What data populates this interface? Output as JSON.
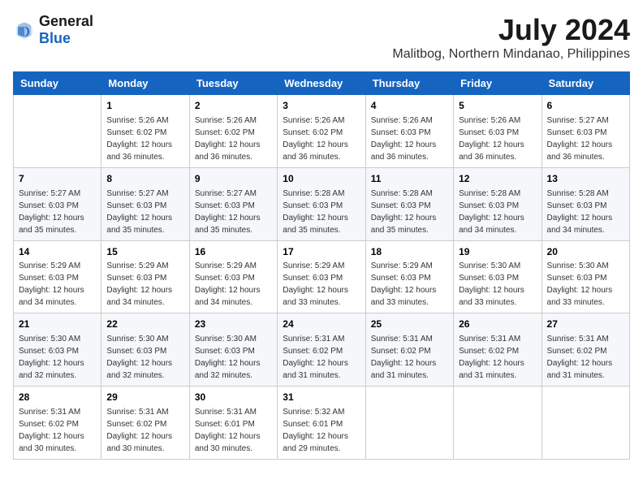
{
  "logo": {
    "text_general": "General",
    "text_blue": "Blue"
  },
  "title": {
    "month_year": "July 2024",
    "location": "Malitbog, Northern Mindanao, Philippines"
  },
  "weekdays": [
    "Sunday",
    "Monday",
    "Tuesday",
    "Wednesday",
    "Thursday",
    "Friday",
    "Saturday"
  ],
  "weeks": [
    [
      {
        "day": "",
        "sunrise": "",
        "sunset": "",
        "daylight": ""
      },
      {
        "day": "1",
        "sunrise": "Sunrise: 5:26 AM",
        "sunset": "Sunset: 6:02 PM",
        "daylight": "Daylight: 12 hours and 36 minutes."
      },
      {
        "day": "2",
        "sunrise": "Sunrise: 5:26 AM",
        "sunset": "Sunset: 6:02 PM",
        "daylight": "Daylight: 12 hours and 36 minutes."
      },
      {
        "day": "3",
        "sunrise": "Sunrise: 5:26 AM",
        "sunset": "Sunset: 6:02 PM",
        "daylight": "Daylight: 12 hours and 36 minutes."
      },
      {
        "day": "4",
        "sunrise": "Sunrise: 5:26 AM",
        "sunset": "Sunset: 6:03 PM",
        "daylight": "Daylight: 12 hours and 36 minutes."
      },
      {
        "day": "5",
        "sunrise": "Sunrise: 5:26 AM",
        "sunset": "Sunset: 6:03 PM",
        "daylight": "Daylight: 12 hours and 36 minutes."
      },
      {
        "day": "6",
        "sunrise": "Sunrise: 5:27 AM",
        "sunset": "Sunset: 6:03 PM",
        "daylight": "Daylight: 12 hours and 36 minutes."
      }
    ],
    [
      {
        "day": "7",
        "sunrise": "Sunrise: 5:27 AM",
        "sunset": "Sunset: 6:03 PM",
        "daylight": "Daylight: 12 hours and 35 minutes."
      },
      {
        "day": "8",
        "sunrise": "Sunrise: 5:27 AM",
        "sunset": "Sunset: 6:03 PM",
        "daylight": "Daylight: 12 hours and 35 minutes."
      },
      {
        "day": "9",
        "sunrise": "Sunrise: 5:27 AM",
        "sunset": "Sunset: 6:03 PM",
        "daylight": "Daylight: 12 hours and 35 minutes."
      },
      {
        "day": "10",
        "sunrise": "Sunrise: 5:28 AM",
        "sunset": "Sunset: 6:03 PM",
        "daylight": "Daylight: 12 hours and 35 minutes."
      },
      {
        "day": "11",
        "sunrise": "Sunrise: 5:28 AM",
        "sunset": "Sunset: 6:03 PM",
        "daylight": "Daylight: 12 hours and 35 minutes."
      },
      {
        "day": "12",
        "sunrise": "Sunrise: 5:28 AM",
        "sunset": "Sunset: 6:03 PM",
        "daylight": "Daylight: 12 hours and 34 minutes."
      },
      {
        "day": "13",
        "sunrise": "Sunrise: 5:28 AM",
        "sunset": "Sunset: 6:03 PM",
        "daylight": "Daylight: 12 hours and 34 minutes."
      }
    ],
    [
      {
        "day": "14",
        "sunrise": "Sunrise: 5:29 AM",
        "sunset": "Sunset: 6:03 PM",
        "daylight": "Daylight: 12 hours and 34 minutes."
      },
      {
        "day": "15",
        "sunrise": "Sunrise: 5:29 AM",
        "sunset": "Sunset: 6:03 PM",
        "daylight": "Daylight: 12 hours and 34 minutes."
      },
      {
        "day": "16",
        "sunrise": "Sunrise: 5:29 AM",
        "sunset": "Sunset: 6:03 PM",
        "daylight": "Daylight: 12 hours and 34 minutes."
      },
      {
        "day": "17",
        "sunrise": "Sunrise: 5:29 AM",
        "sunset": "Sunset: 6:03 PM",
        "daylight": "Daylight: 12 hours and 33 minutes."
      },
      {
        "day": "18",
        "sunrise": "Sunrise: 5:29 AM",
        "sunset": "Sunset: 6:03 PM",
        "daylight": "Daylight: 12 hours and 33 minutes."
      },
      {
        "day": "19",
        "sunrise": "Sunrise: 5:30 AM",
        "sunset": "Sunset: 6:03 PM",
        "daylight": "Daylight: 12 hours and 33 minutes."
      },
      {
        "day": "20",
        "sunrise": "Sunrise: 5:30 AM",
        "sunset": "Sunset: 6:03 PM",
        "daylight": "Daylight: 12 hours and 33 minutes."
      }
    ],
    [
      {
        "day": "21",
        "sunrise": "Sunrise: 5:30 AM",
        "sunset": "Sunset: 6:03 PM",
        "daylight": "Daylight: 12 hours and 32 minutes."
      },
      {
        "day": "22",
        "sunrise": "Sunrise: 5:30 AM",
        "sunset": "Sunset: 6:03 PM",
        "daylight": "Daylight: 12 hours and 32 minutes."
      },
      {
        "day": "23",
        "sunrise": "Sunrise: 5:30 AM",
        "sunset": "Sunset: 6:03 PM",
        "daylight": "Daylight: 12 hours and 32 minutes."
      },
      {
        "day": "24",
        "sunrise": "Sunrise: 5:31 AM",
        "sunset": "Sunset: 6:02 PM",
        "daylight": "Daylight: 12 hours and 31 minutes."
      },
      {
        "day": "25",
        "sunrise": "Sunrise: 5:31 AM",
        "sunset": "Sunset: 6:02 PM",
        "daylight": "Daylight: 12 hours and 31 minutes."
      },
      {
        "day": "26",
        "sunrise": "Sunrise: 5:31 AM",
        "sunset": "Sunset: 6:02 PM",
        "daylight": "Daylight: 12 hours and 31 minutes."
      },
      {
        "day": "27",
        "sunrise": "Sunrise: 5:31 AM",
        "sunset": "Sunset: 6:02 PM",
        "daylight": "Daylight: 12 hours and 31 minutes."
      }
    ],
    [
      {
        "day": "28",
        "sunrise": "Sunrise: 5:31 AM",
        "sunset": "Sunset: 6:02 PM",
        "daylight": "Daylight: 12 hours and 30 minutes."
      },
      {
        "day": "29",
        "sunrise": "Sunrise: 5:31 AM",
        "sunset": "Sunset: 6:02 PM",
        "daylight": "Daylight: 12 hours and 30 minutes."
      },
      {
        "day": "30",
        "sunrise": "Sunrise: 5:31 AM",
        "sunset": "Sunset: 6:01 PM",
        "daylight": "Daylight: 12 hours and 30 minutes."
      },
      {
        "day": "31",
        "sunrise": "Sunrise: 5:32 AM",
        "sunset": "Sunset: 6:01 PM",
        "daylight": "Daylight: 12 hours and 29 minutes."
      },
      {
        "day": "",
        "sunrise": "",
        "sunset": "",
        "daylight": ""
      },
      {
        "day": "",
        "sunrise": "",
        "sunset": "",
        "daylight": ""
      },
      {
        "day": "",
        "sunrise": "",
        "sunset": "",
        "daylight": ""
      }
    ]
  ]
}
